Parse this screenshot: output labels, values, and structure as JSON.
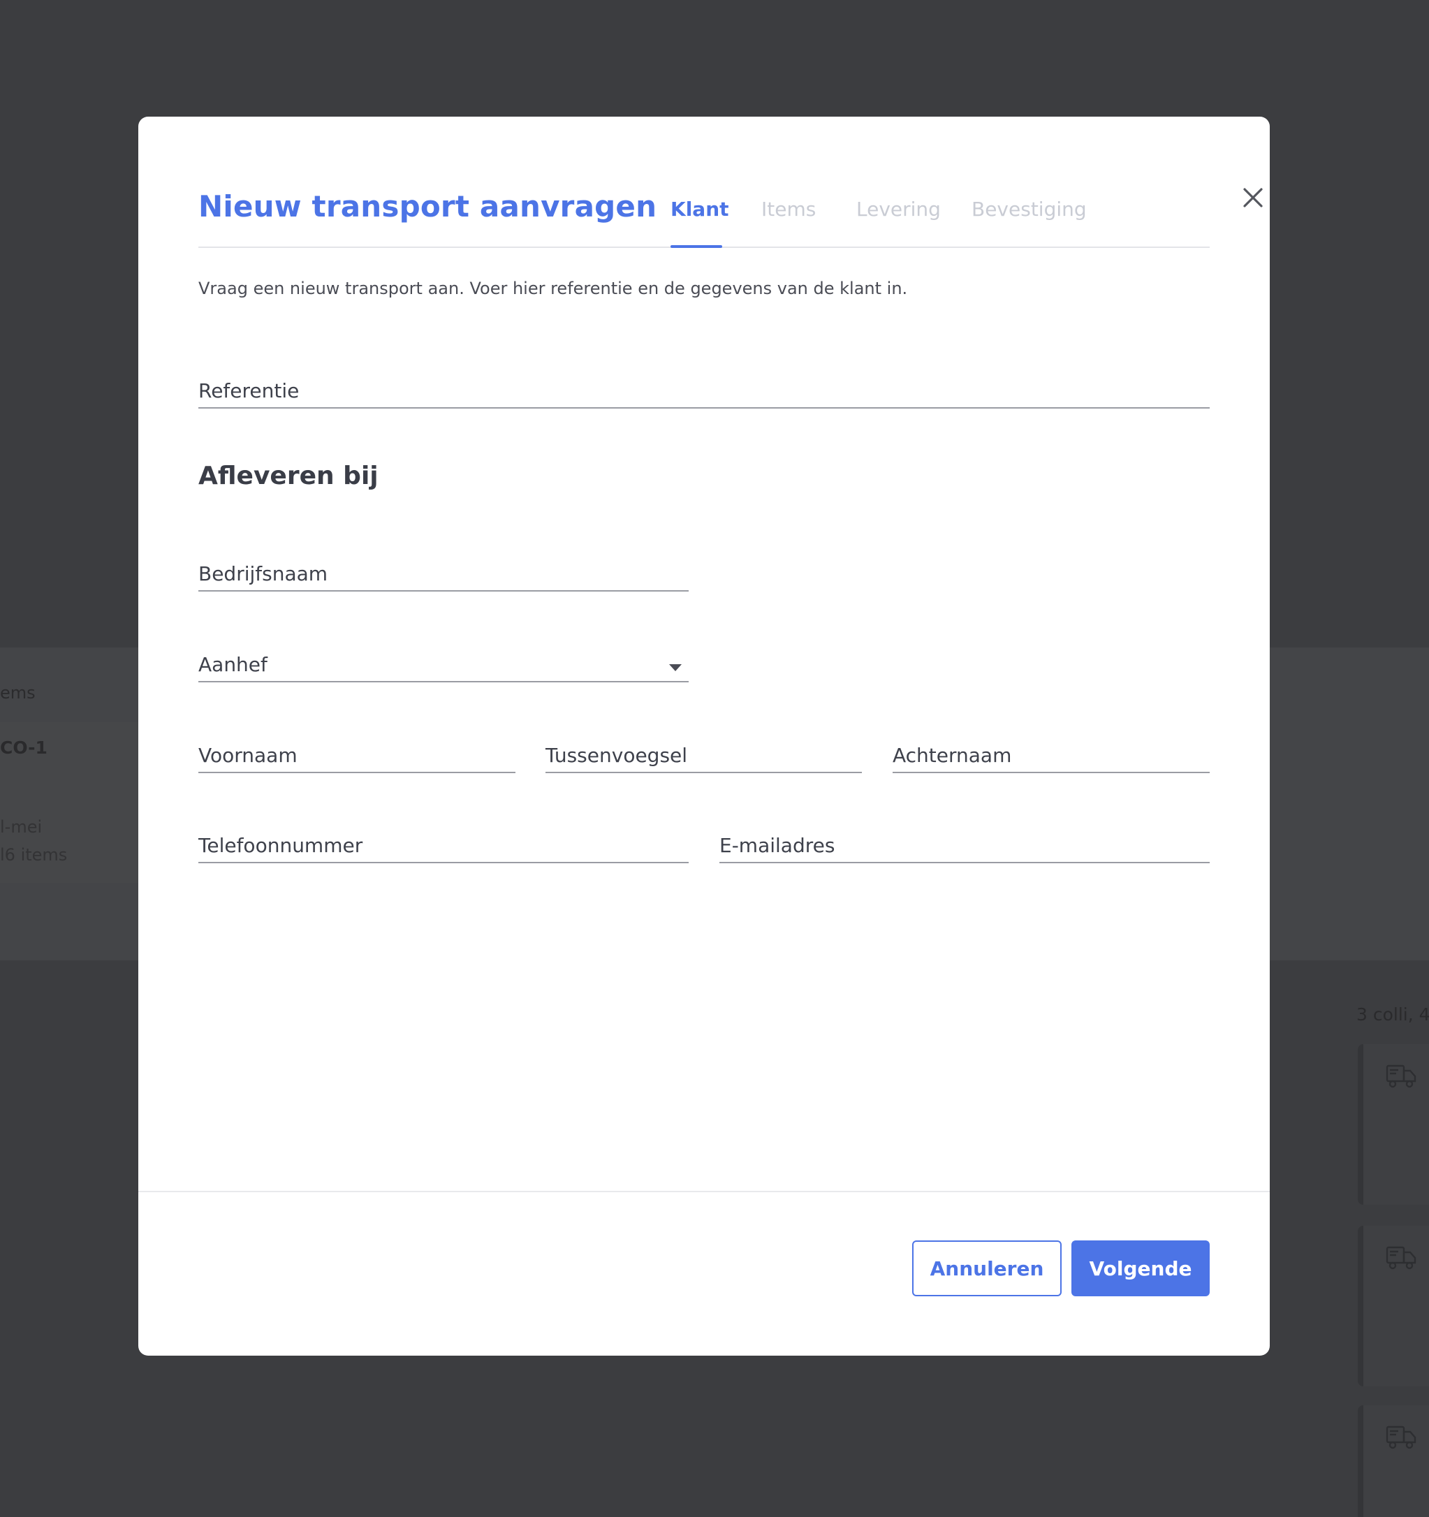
{
  "background": {
    "items_header": "ems",
    "card_title": "CO-1",
    "card_date": "l-mei",
    "card_count": "l6 items",
    "right_summary": "3 colli, 4",
    "truck_icon": "truck-icon"
  },
  "modal": {
    "title": "Nieuw transport aanvragen",
    "tabs": [
      {
        "label": "Klant",
        "active": true
      },
      {
        "label": "Items",
        "active": false
      },
      {
        "label": "Levering",
        "active": false
      },
      {
        "label": "Bevestiging",
        "active": false
      }
    ],
    "close_icon": "close-icon",
    "intro": "Vraag een nieuw transport aan. Voer hier referentie en de gegevens van de klant in.",
    "fields": {
      "referentie": {
        "label": "Referentie",
        "value": ""
      },
      "section_heading": "Afleveren bij",
      "bedrijfsnaam": {
        "label": "Bedrijfsnaam",
        "value": ""
      },
      "aanhef": {
        "label": "Aanhef",
        "value": ""
      },
      "voornaam": {
        "label": "Voornaam",
        "value": ""
      },
      "tussenvoegsel": {
        "label": "Tussenvoegsel",
        "value": ""
      },
      "achternaam": {
        "label": "Achternaam",
        "value": ""
      },
      "telefoonnummer": {
        "label": "Telefoonnummer",
        "value": ""
      },
      "emailadres": {
        "label": "E-mailadres",
        "value": ""
      }
    },
    "buttons": {
      "cancel": "Annuleren",
      "next": "Volgende"
    }
  },
  "colors": {
    "accent": "#4c74e6",
    "overlay": "#3c3d40",
    "tab_inactive": "#c9ccd4"
  }
}
